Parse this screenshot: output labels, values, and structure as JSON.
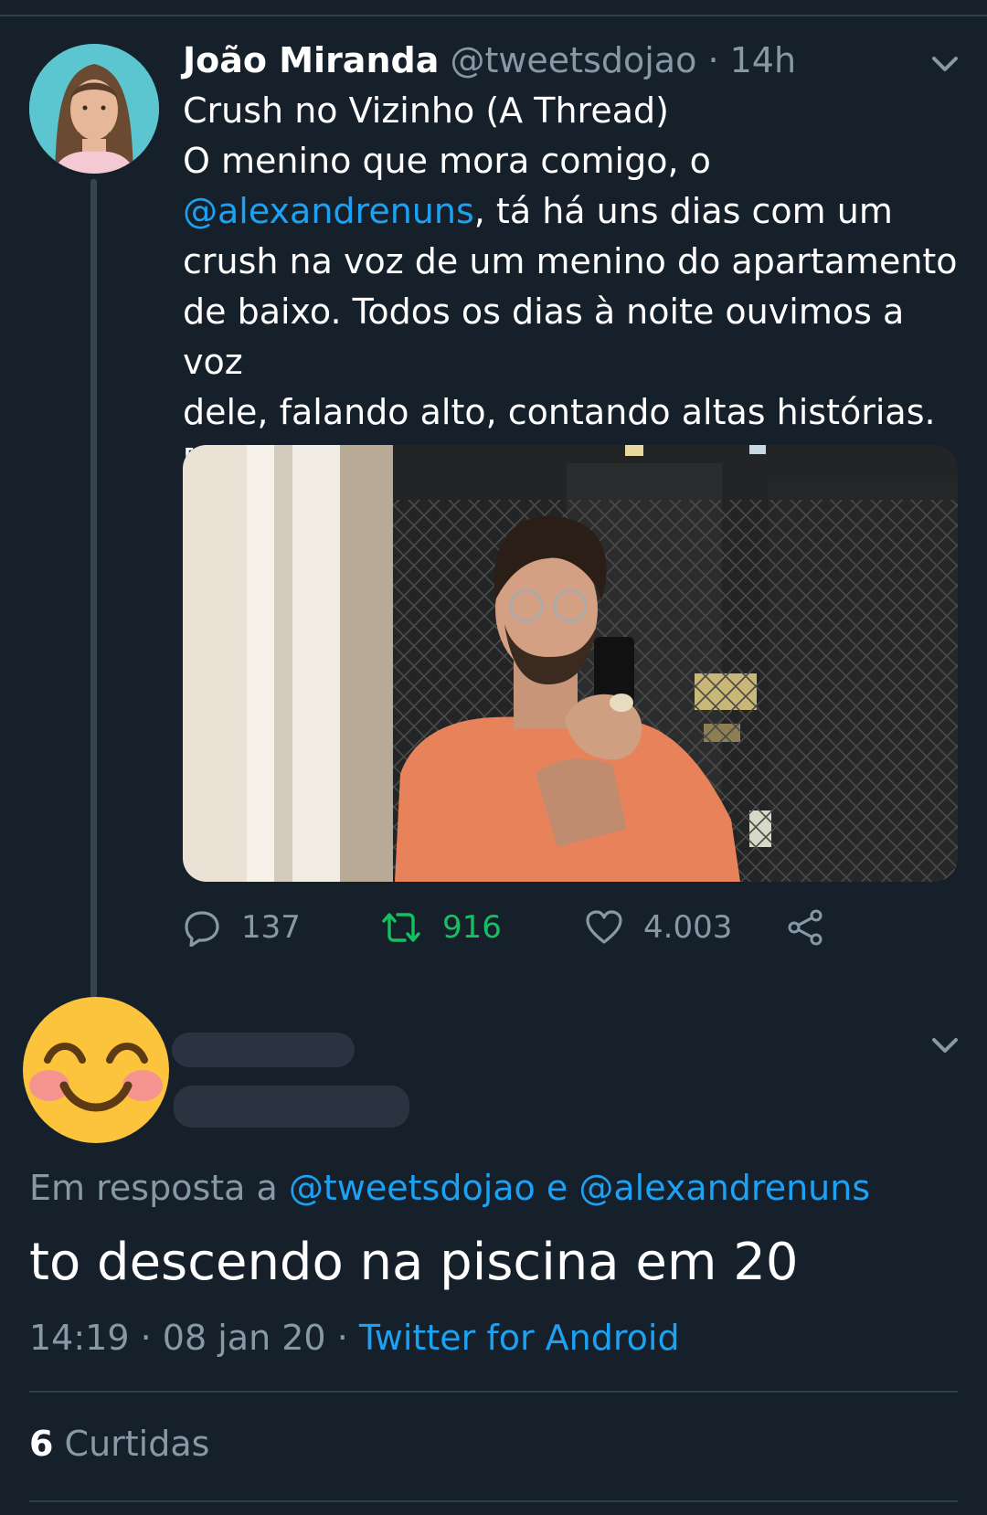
{
  "tweet": {
    "author_name": "João Miranda",
    "handle": "@tweetsdojao",
    "separator": "·",
    "time": "14h",
    "text_line1": "Crush no Vizinho (A Thread)\nO menino que mora comigo, o\n",
    "mention": "@alexandrenuns",
    "text_line2": ", tá há uns dias com um\ncrush na voz de um menino do apartamento\nde baixo. Todos os dias à noite ouvimos a voz\ndele, falando alto, contando altas histórias.\n[+]",
    "replies": "137",
    "retweets": "916",
    "likes": "4.003"
  },
  "reply": {
    "context_prefix": "Em resposta a",
    "context_user1": "@tweetsdojao",
    "context_and": "e",
    "context_user2": "@alexandrenuns",
    "text": "to descendo na piscina em 20",
    "time": "14:19",
    "dot": "·",
    "date": "08 jan 20",
    "source": "Twitter for Android",
    "likes_count": "6",
    "likes_label": "Curtidas"
  },
  "colors": {
    "background": "#15202b",
    "link": "#1da1f2",
    "secondary": "#8899a6",
    "retweet": "#17bf63"
  }
}
